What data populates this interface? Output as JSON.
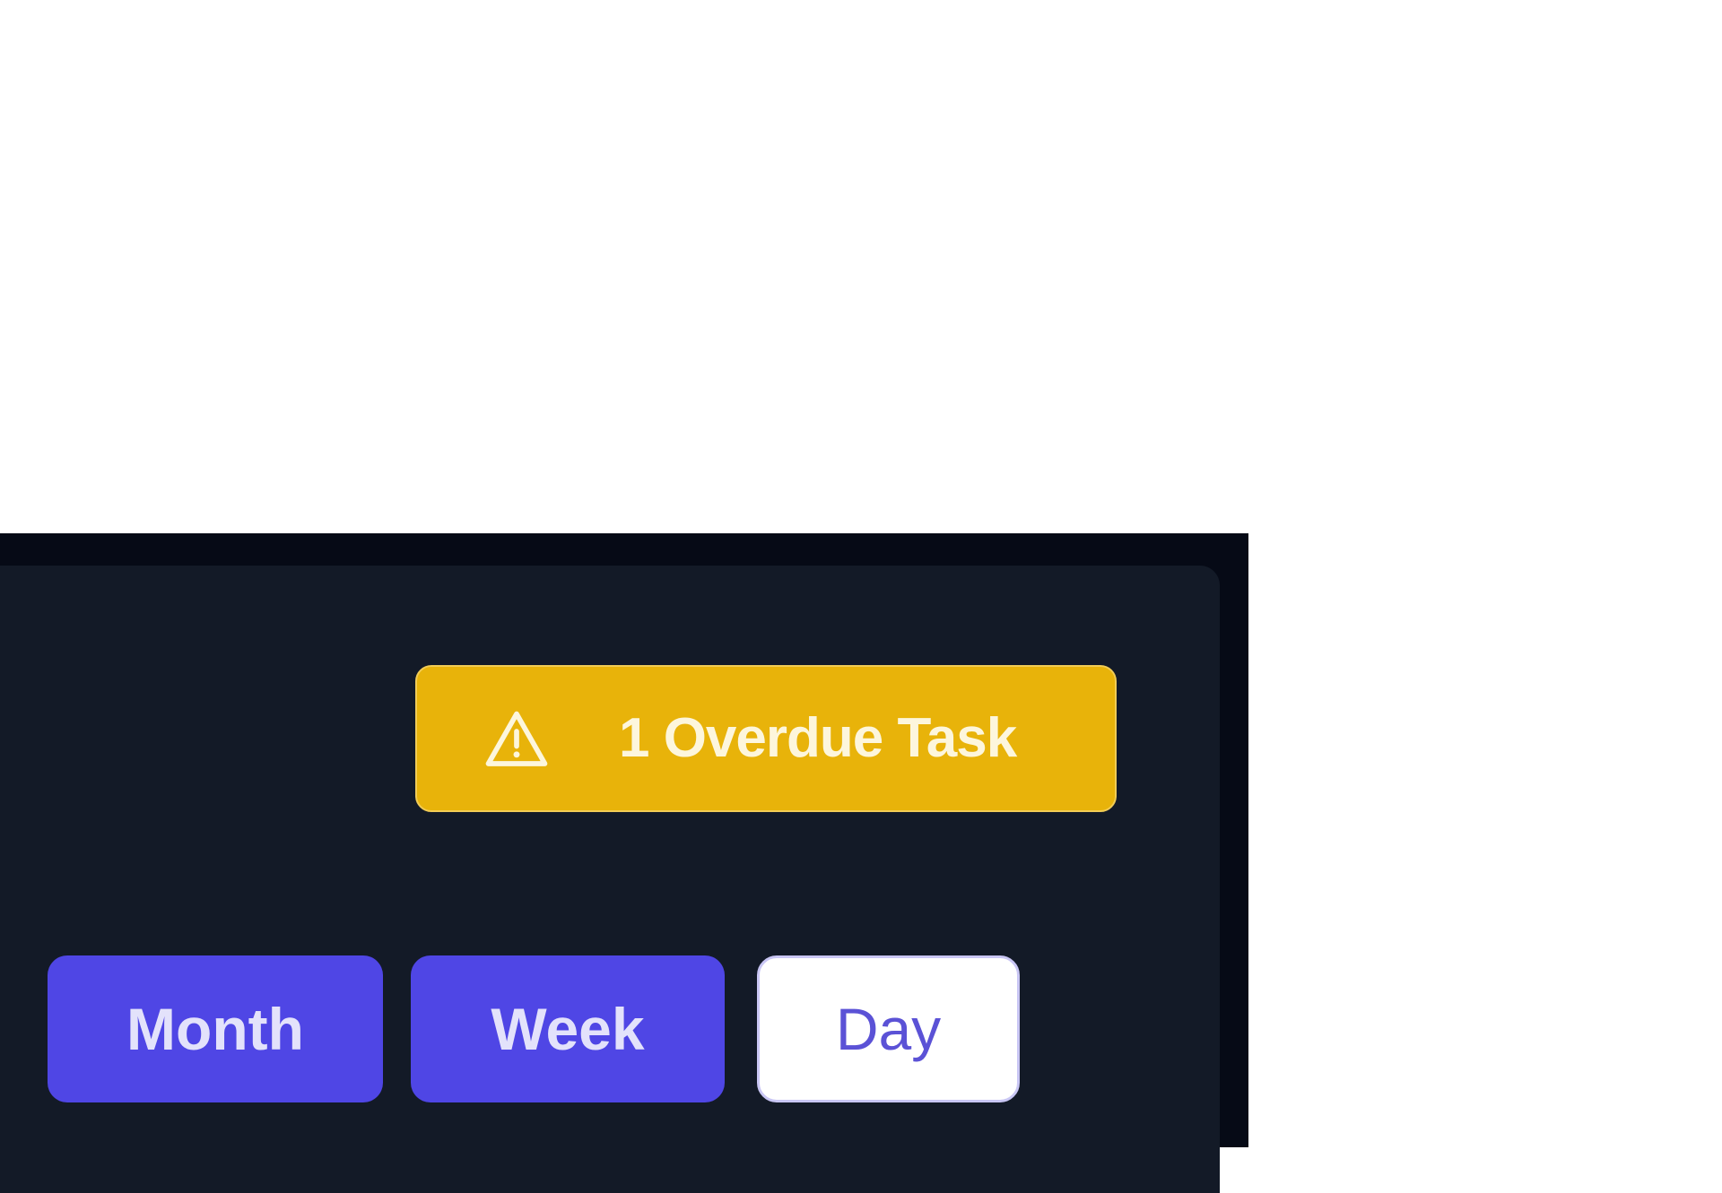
{
  "alert": {
    "icon": "warning-triangle-icon",
    "text": "1 Overdue Task",
    "color": "#e8b30a"
  },
  "view_toggle": {
    "options": [
      {
        "label": "Month",
        "active": false
      },
      {
        "label": "Week",
        "active": false
      },
      {
        "label": "Day",
        "active": true
      }
    ],
    "accent": "#4f46e5"
  }
}
